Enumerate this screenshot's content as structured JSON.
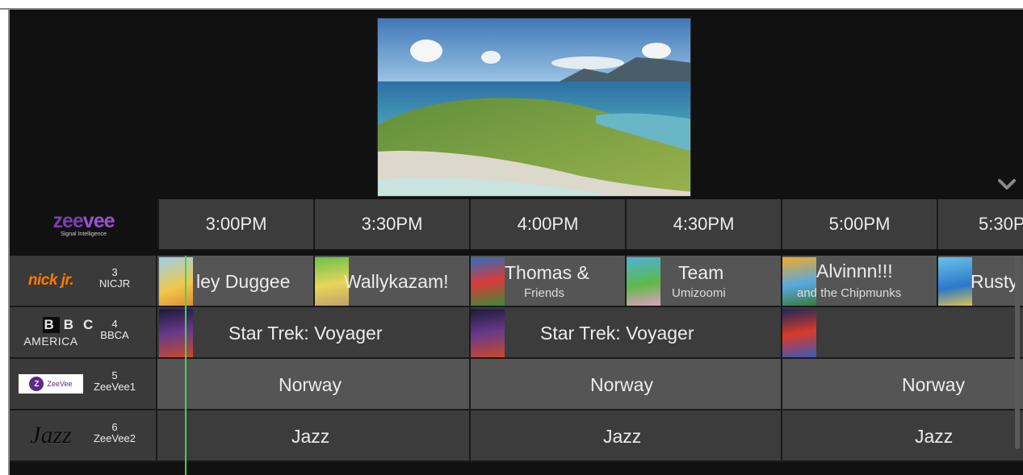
{
  "brand": {
    "name_part1": "zee",
    "name_part2": "vee",
    "tagline": "Signal Intelligence"
  },
  "preview": {
    "description_icon": "landscape-preview-icon"
  },
  "controls": {
    "collapse_icon": "chevron-down-icon"
  },
  "timeslots": [
    "3:00PM",
    "3:30PM",
    "4:00PM",
    "4:30PM",
    "5:00PM",
    "5:30PM"
  ],
  "channels": [
    {
      "number": "3",
      "code": "NICJR",
      "logo_text": "nick jr."
    },
    {
      "number": "4",
      "code": "BBCA",
      "logo_line1": "BBC",
      "logo_line2": "AMERICA"
    },
    {
      "number": "5",
      "code": "ZeeVee1",
      "logo_text": "ZeeVee"
    },
    {
      "number": "6",
      "code": "ZeeVee2",
      "logo_text": "Jazz"
    }
  ],
  "programs": {
    "nicjr": [
      {
        "title": "ley Duggee"
      },
      {
        "title": "Wallykazam!"
      },
      {
        "title": "Thomas &",
        "subtitle": "Friends"
      },
      {
        "title": "Team",
        "subtitle": "Umizoomi"
      },
      {
        "title": "Alvinnn!!!",
        "subtitle": "and the Chipmunks"
      },
      {
        "title": "Rusty"
      }
    ],
    "bbca": [
      {
        "title": "Star Trek: Voyager"
      },
      {
        "title": "Star Trek: Voyager"
      },
      {
        "title": ""
      }
    ],
    "zeevee1": [
      {
        "title": "Norway"
      },
      {
        "title": "Norway"
      },
      {
        "title": "Norway"
      }
    ],
    "zeevee2": [
      {
        "title": "Jazz"
      },
      {
        "title": "Jazz"
      },
      {
        "title": "Jazz"
      }
    ]
  },
  "colors": {
    "now_line": "#3bd84a",
    "brand_purple": "#9c4fd6",
    "nick_orange": "#ff7a00"
  }
}
